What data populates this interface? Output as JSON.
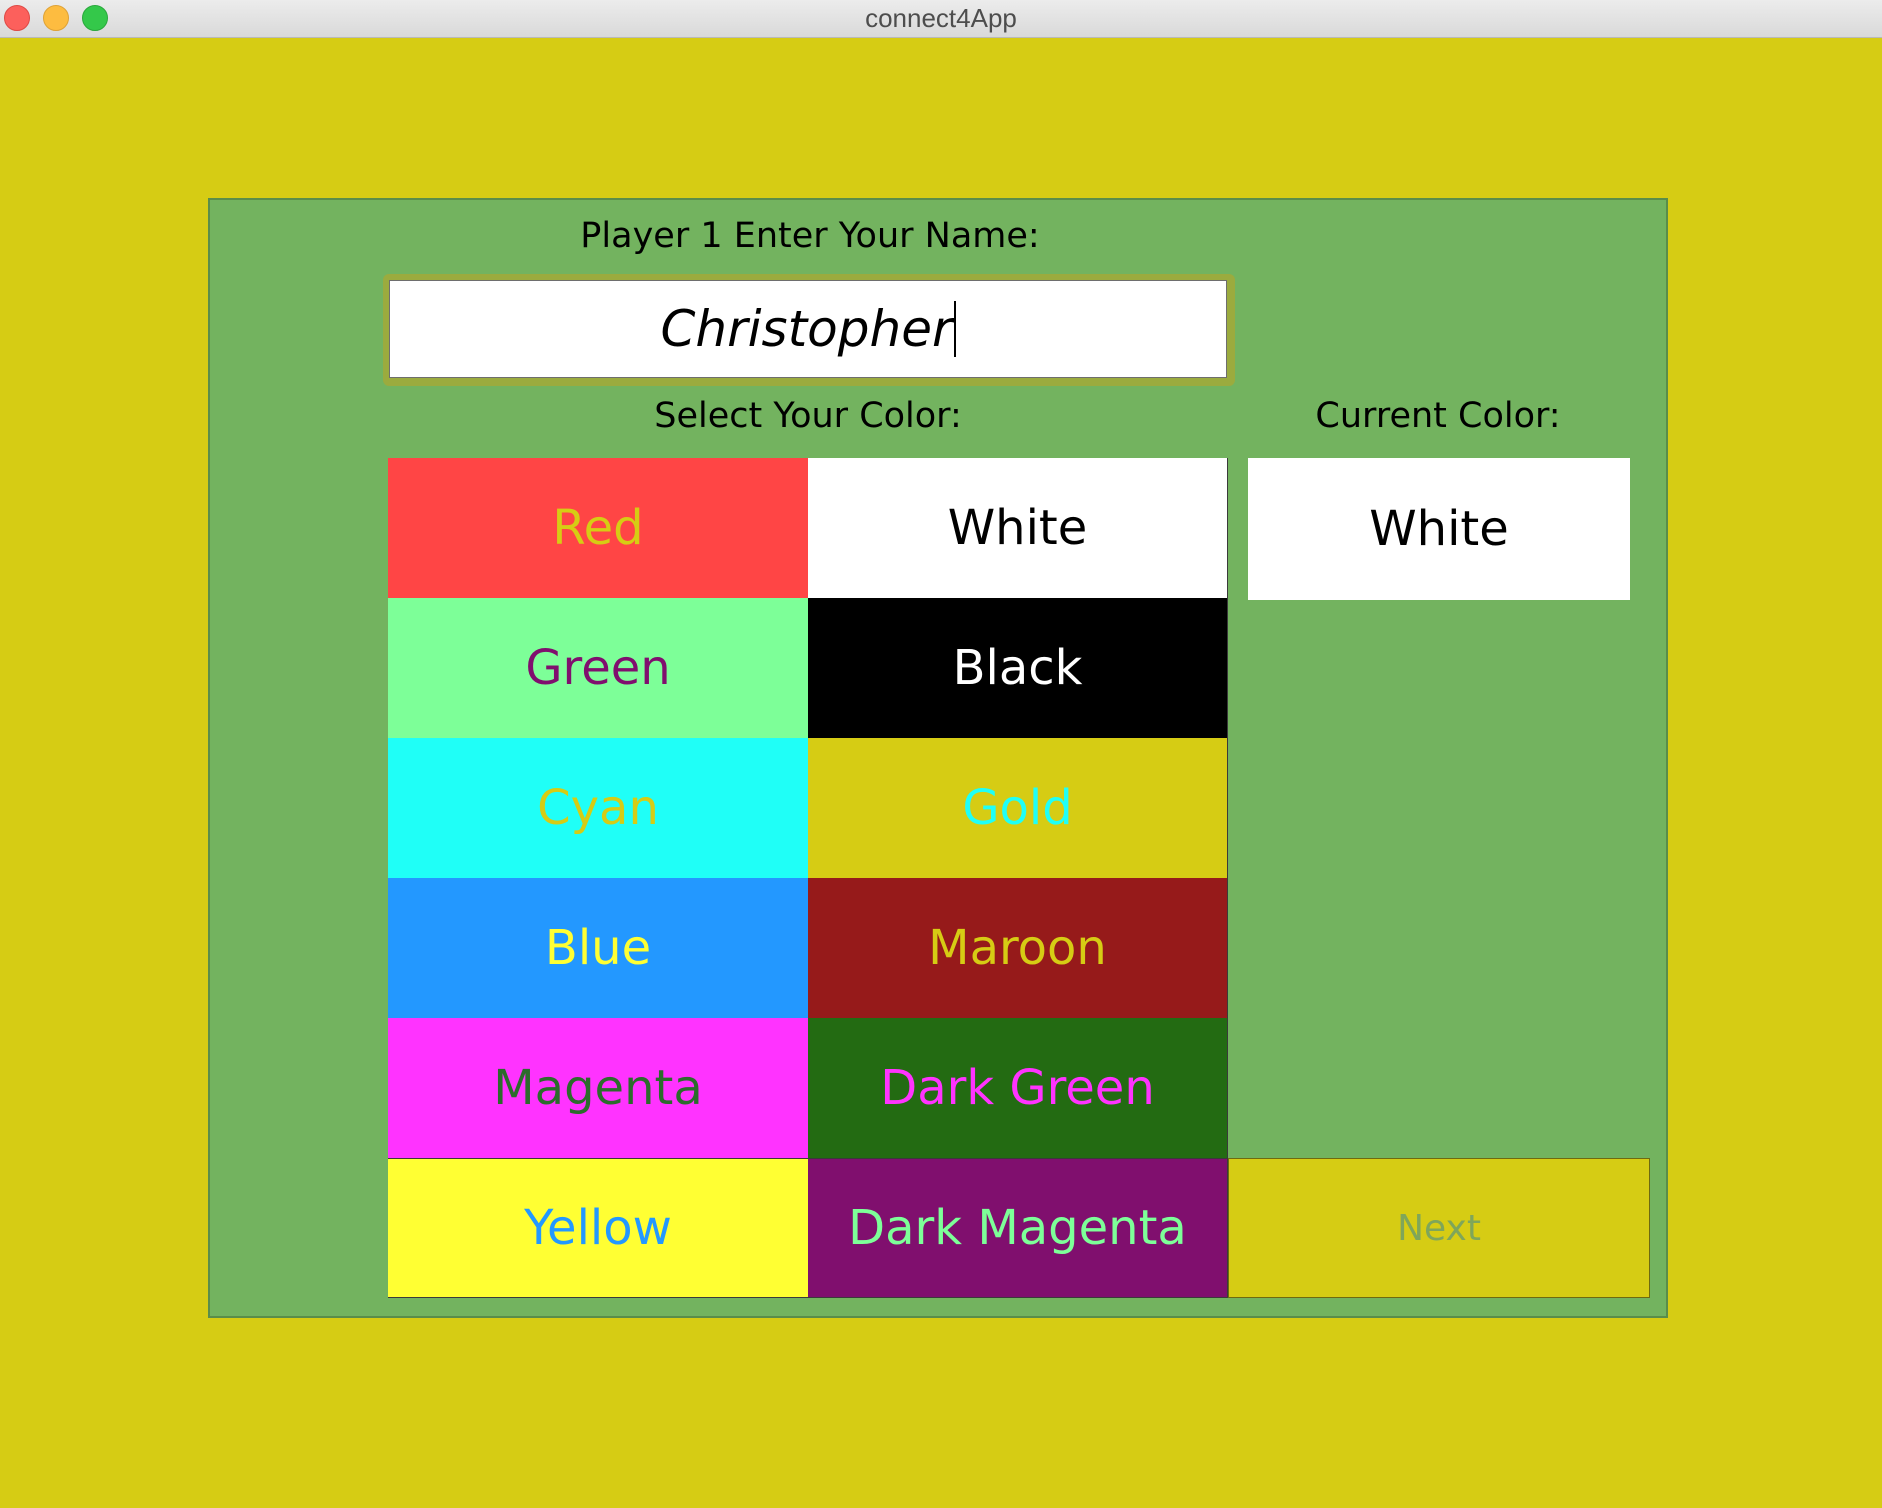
{
  "window": {
    "title": "connect4App",
    "background": "#d6cc14"
  },
  "form": {
    "name_label": "Player 1 Enter Your Name:",
    "name_value": "Christopher",
    "select_color_label": "Select Your Color:",
    "current_color_label": "Current Color:",
    "current_color_value": "White",
    "current_color_bg": "#ffffff",
    "current_color_fg": "#000000",
    "next_label": "Next",
    "next_bg": "#d6cc14",
    "next_fg": "#7fa65a"
  },
  "colors": [
    {
      "label": "Red",
      "bg": "#ff4545",
      "fg": "#d6cc14"
    },
    {
      "label": "White",
      "bg": "#ffffff",
      "fg": "#000000"
    },
    {
      "label": "Green",
      "bg": "#7dff98",
      "fg": "#800f6e"
    },
    {
      "label": "Black",
      "bg": "#000000",
      "fg": "#ffffff"
    },
    {
      "label": "Cyan",
      "bg": "#1ffff7",
      "fg": "#d6cc14"
    },
    {
      "label": "Gold",
      "bg": "#d6cc14",
      "fg": "#1ffff7"
    },
    {
      "label": "Blue",
      "bg": "#2398ff",
      "fg": "#ffff33"
    },
    {
      "label": "Maroon",
      "bg": "#961a1a",
      "fg": "#d6cc14"
    },
    {
      "label": "Magenta",
      "bg": "#ff33ff",
      "fg": "#2d6b2d"
    },
    {
      "label": "Dark Green",
      "bg": "#236b12",
      "fg": "#ff33ff"
    },
    {
      "label": "Yellow",
      "bg": "#ffff33",
      "fg": "#2398ff"
    },
    {
      "label": "Dark Magenta",
      "bg": "#800f6e",
      "fg": "#7dff98"
    }
  ]
}
